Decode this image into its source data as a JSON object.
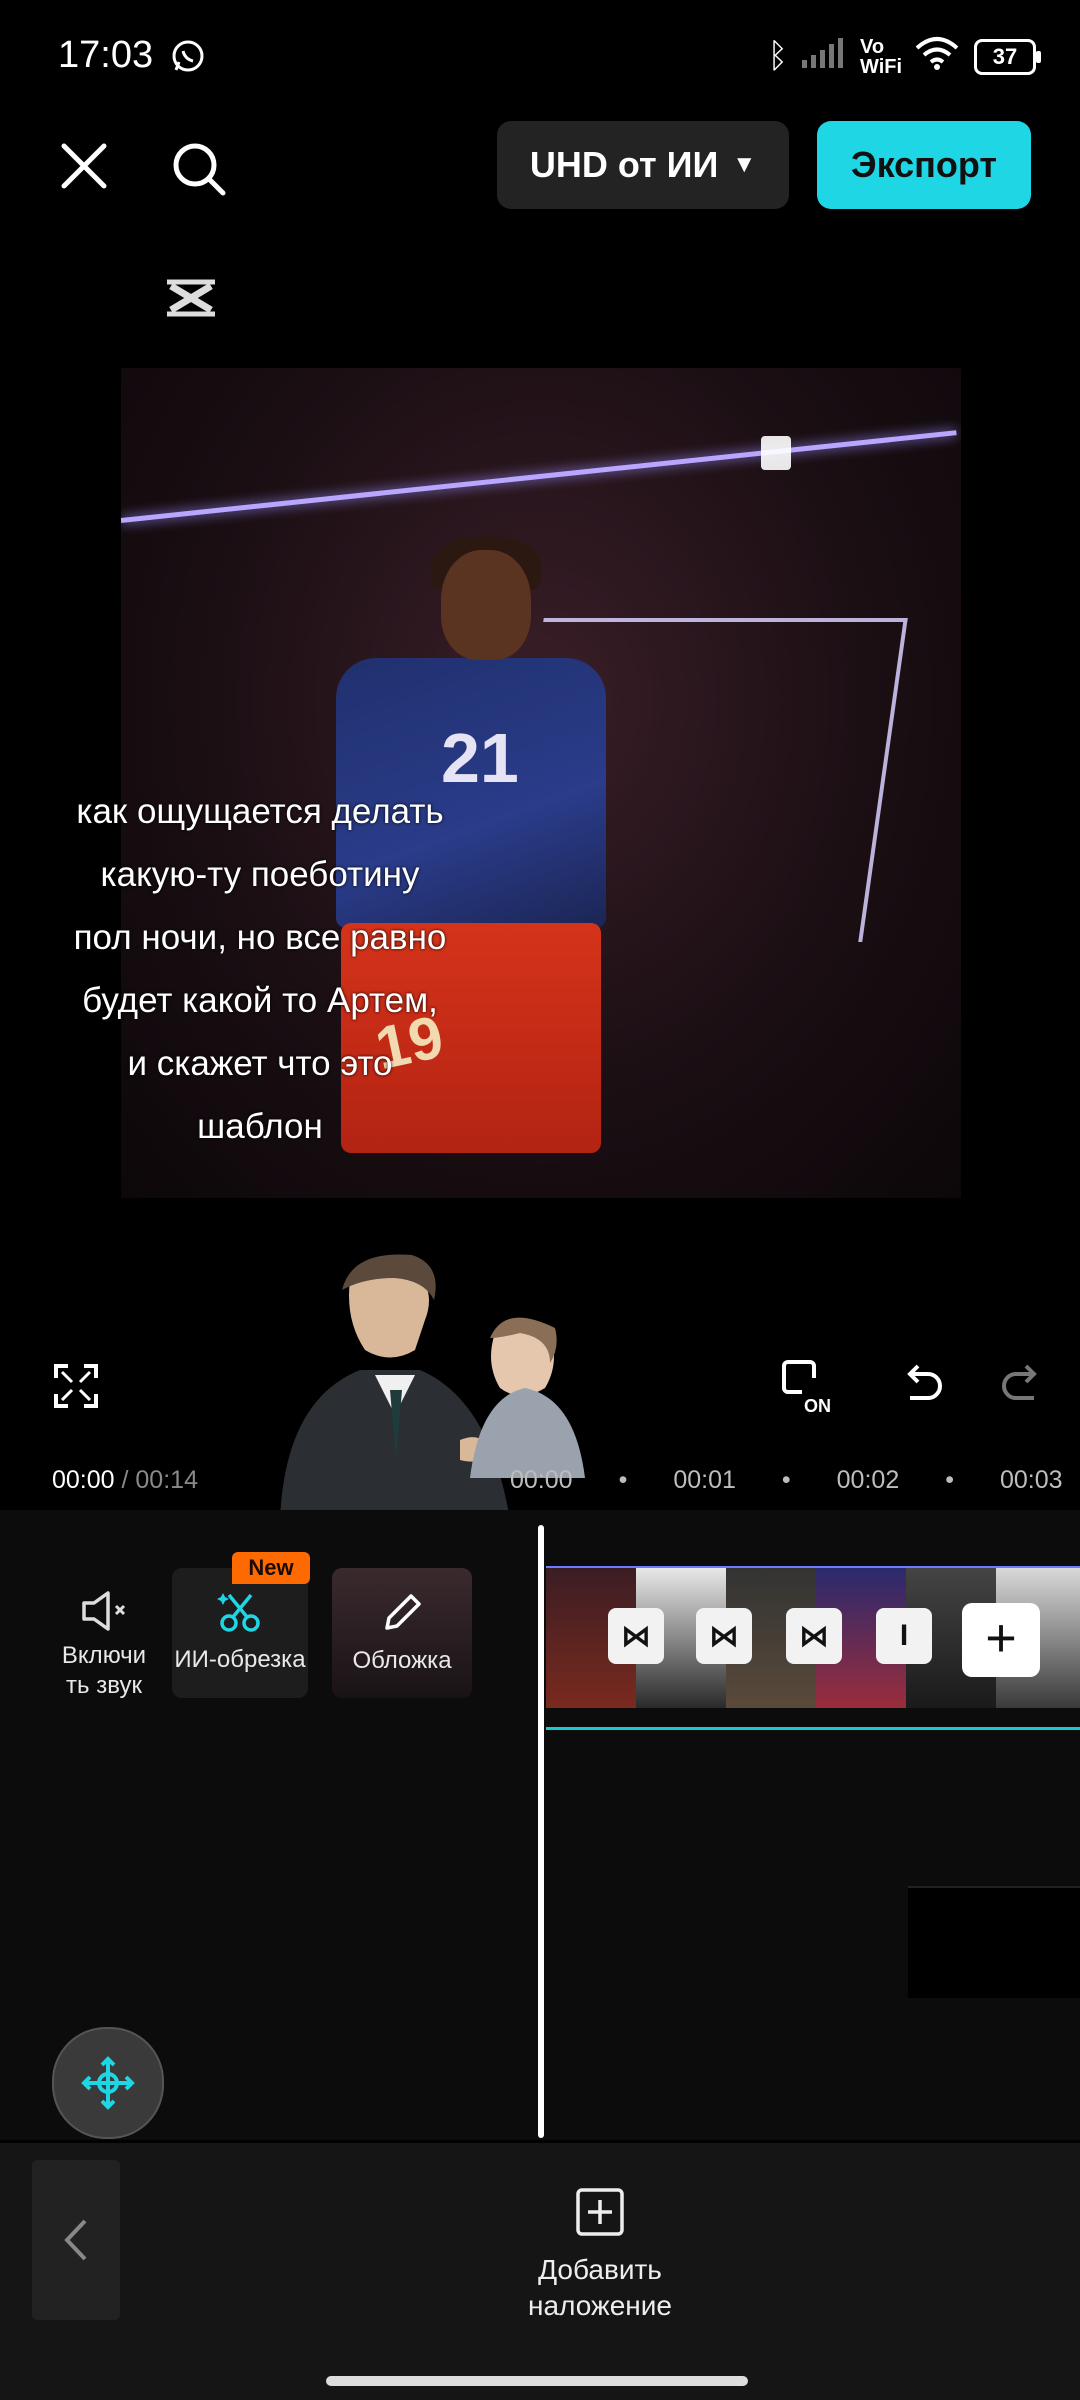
{
  "status": {
    "time": "17:03",
    "network": "Vo WiFi",
    "battery": "37"
  },
  "toolbar": {
    "quality_label": "UHD от ИИ",
    "export_label": "Экспорт"
  },
  "preview": {
    "caption": "как ощущается делать какую-ту поеботину пол ночи, но все равно будет какой то Артем, и скажет что это шаблон",
    "shirt_number": "21",
    "shorts_number": "19"
  },
  "playback": {
    "current_time": "00:00",
    "total_time": "/ 00:14",
    "ruler_marks": [
      "00:00",
      "00:01",
      "00:02",
      "00:03"
    ]
  },
  "tools": {
    "sound_label": "Включи ть звук",
    "ai_crop_label": "ИИ-обрезка",
    "new_badge": "New",
    "cover_label": "Обложка"
  },
  "bottom": {
    "add_overlay_label": "Добавить наложение"
  },
  "colors": {
    "accent": "#1fd6e5",
    "badge": "#ff6a00",
    "timeline_line": "#18c9cf"
  }
}
